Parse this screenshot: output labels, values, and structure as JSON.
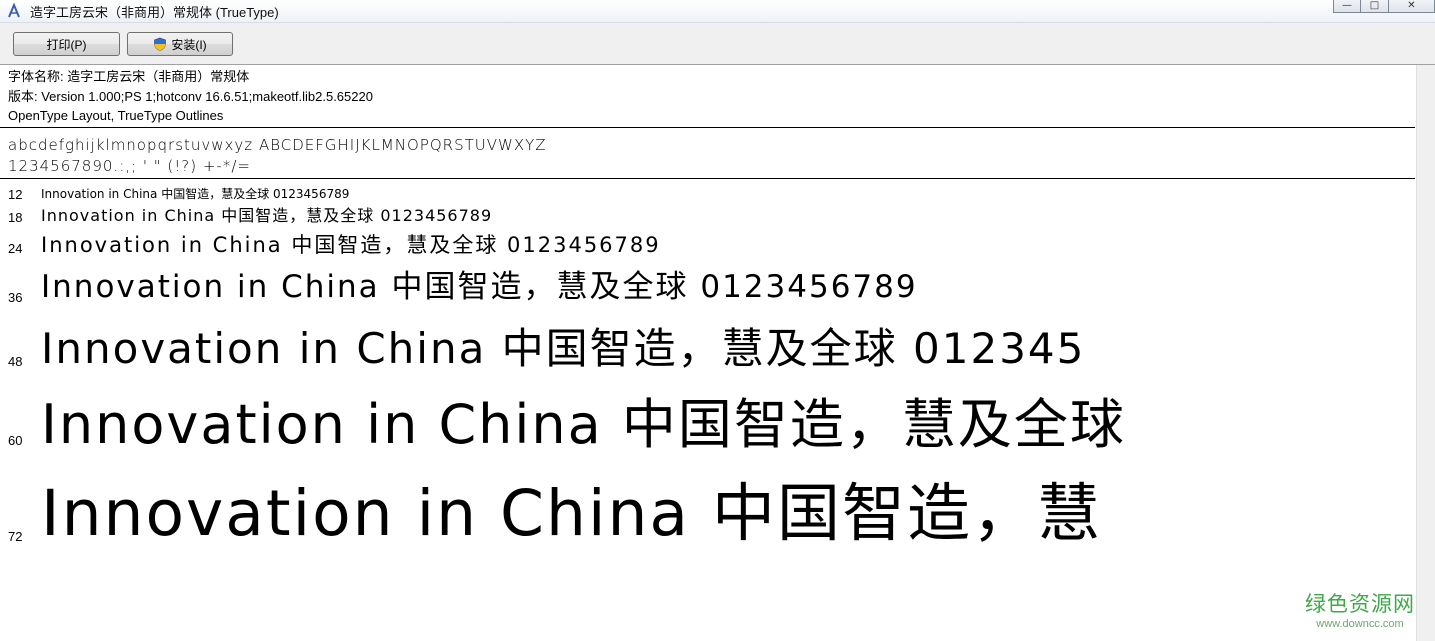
{
  "window": {
    "title": "造字工房云宋（非商用）常规体 (TrueType)",
    "controls": {
      "minimize": "—",
      "maximize": "□",
      "close": "✕"
    }
  },
  "toolbar": {
    "print_label": "打印(P)",
    "install_label": "安装(I)"
  },
  "info": {
    "font_name": "字体名称: 造字工房云宋（非商用）常规体",
    "version": "版本: Version 1.000;PS 1;hotconv 16.6.51;makeotf.lib2.5.65220",
    "layout": "OpenType Layout, TrueType Outlines"
  },
  "glyphs": {
    "letters": "abcdefghijklmnopqrstuvwxyz ABCDEFGHIJKLMNOPQRSTUVWXYZ",
    "digits": "1234567890.:,; ' \" (!?) +-*/="
  },
  "samples": [
    {
      "size": "12",
      "text": "Innovation in China 中国智造，慧及全球 0123456789"
    },
    {
      "size": "18",
      "text": "Innovation in China 中国智造，慧及全球 0123456789"
    },
    {
      "size": "24",
      "text": "Innovation in China 中国智造，慧及全球 0123456789"
    },
    {
      "size": "36",
      "text": "Innovation in China 中国智造，慧及全球 0123456789"
    },
    {
      "size": "48",
      "text": "Innovation in China 中国智造，慧及全球 012345"
    },
    {
      "size": "60",
      "text": "Innovation in China 中国智造，慧及全球"
    },
    {
      "size": "72",
      "text": "Innovation in China 中国智造，慧"
    }
  ],
  "watermark": {
    "main": "绿色资源网",
    "url": "www.downcc.com"
  },
  "colors": {
    "watermark_green": "#3ea84a",
    "shield_blue": "#2f6fd1",
    "shield_yellow": "#f2c21b"
  }
}
